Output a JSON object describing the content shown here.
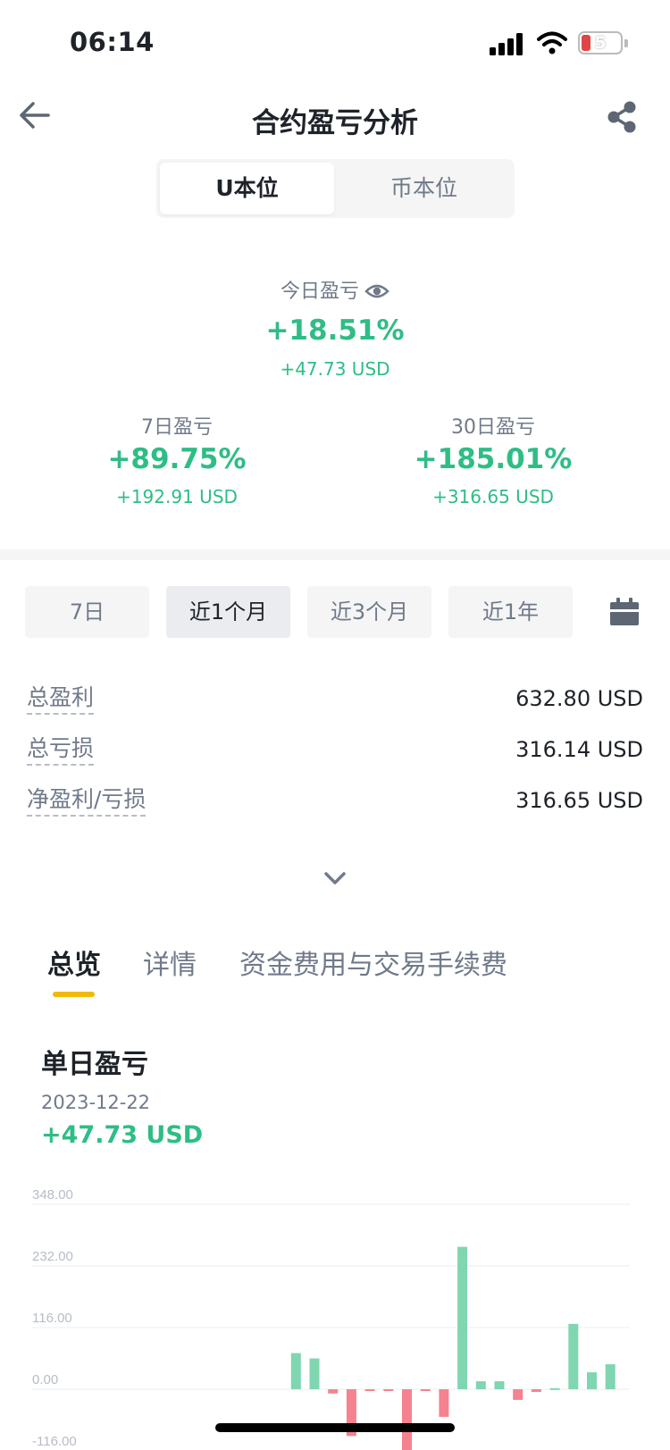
{
  "status_bar": {
    "time": "06:14",
    "battery": "5"
  },
  "header": {
    "title": "合约盈亏分析"
  },
  "segment": {
    "left": "U本位",
    "right": "币本位",
    "selected": "U本位"
  },
  "today": {
    "label": "今日盈亏",
    "percent": "+18.51%",
    "usd": "+47.73 USD"
  },
  "week": {
    "label": "7日盈亏",
    "percent": "+89.75%",
    "usd": "+192.91 USD"
  },
  "month": {
    "label": "30日盈亏",
    "percent": "+185.01%",
    "usd": "+316.65 USD"
  },
  "periods": [
    "7日",
    "近1个月",
    "近3个月",
    "近1年"
  ],
  "period_selected": "近1个月",
  "stats": [
    {
      "label": "总盈利",
      "value": "632.80 USD"
    },
    {
      "label": "总亏损",
      "value": "316.14 USD"
    },
    {
      "label": "净盈利/亏损",
      "value": "316.65 USD"
    }
  ],
  "content_tabs": [
    "总览",
    "详情",
    "资金费用与交易手续费"
  ],
  "content_tab_selected": "总览",
  "daily": {
    "title": "单日盈亏",
    "date": "2023-12-22",
    "value": "+47.73 USD"
  },
  "colors": {
    "up": "#2ebd85",
    "down": "#f6465d",
    "accent": "#f0b90b"
  },
  "chart_data": {
    "type": "bar",
    "ylim": [
      -116,
      348
    ],
    "yticks": [
      "348.00",
      "232.00",
      "116.00",
      "0.00",
      "-116.00"
    ],
    "ytick_values": [
      348,
      232,
      116,
      0,
      -116
    ],
    "values": [
      0,
      0,
      0,
      0,
      0,
      0,
      0,
      0,
      0,
      0,
      0,
      0,
      0,
      0,
      68,
      58,
      -8,
      -88,
      -2,
      -2,
      -125,
      -3,
      -52,
      268,
      15,
      15,
      -20,
      -5,
      2,
      123,
      32,
      47
    ]
  }
}
